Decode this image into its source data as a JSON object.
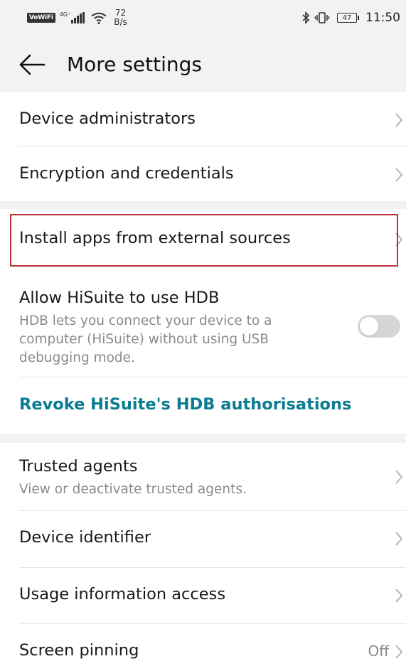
{
  "status_bar": {
    "vowifi": "VoWiFi",
    "network_type": "4G⁺",
    "network_rate_value": "72",
    "network_rate_unit": "B/s",
    "battery_level": "47",
    "time": "11:50"
  },
  "header": {
    "title": "More settings"
  },
  "items": [
    {
      "label": "Device administrators"
    },
    {
      "label": "Encryption and credentials"
    },
    {
      "label": "Install apps from external sources"
    },
    {
      "label": "Allow HiSuite to use HDB",
      "description": "HDB lets you connect your device to a computer (HiSuite) without using USB debugging mode.",
      "toggle_on": false
    },
    {
      "label": "Revoke HiSuite's HDB authorisations"
    },
    {
      "label": "Trusted agents",
      "description": "View or deactivate trusted agents."
    },
    {
      "label": "Device identifier"
    },
    {
      "label": "Usage information access"
    },
    {
      "label": "Screen pinning",
      "value": "Off"
    }
  ],
  "colors": {
    "accent_link": "#0a7c92",
    "highlight_box": "#c0323a"
  }
}
